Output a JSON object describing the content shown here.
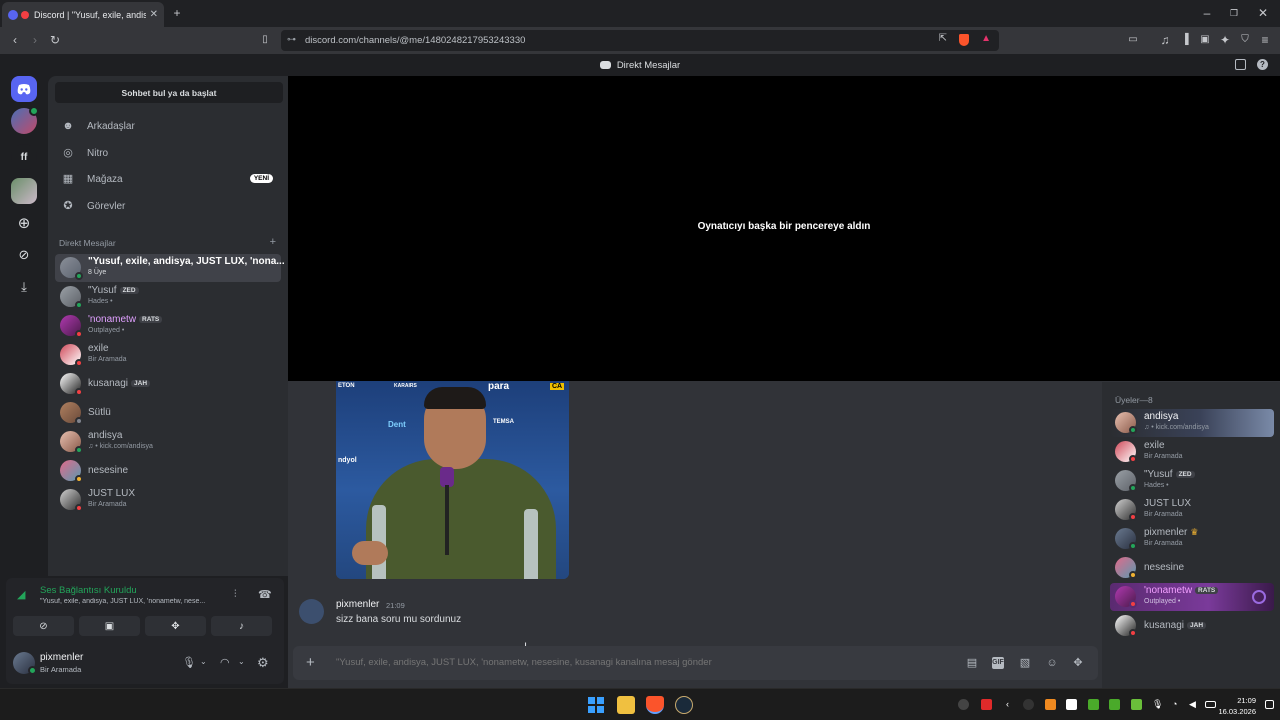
{
  "browser": {
    "tab_title": "Discord | \"Yusuf, exile, andis...",
    "url": "discord.com/channels/@me/1480248217953243330",
    "new_tab": "+"
  },
  "topbar": {
    "title": "Direkt Mesajlar"
  },
  "sidebar": {
    "search_button": "Sohbet bul ya da başlat",
    "nav": [
      {
        "label": "Arkadaşlar",
        "icon": "friends-icon"
      },
      {
        "label": "Nitro",
        "icon": "nitro-icon"
      },
      {
        "label": "Mağaza",
        "icon": "shop-icon",
        "badge": "YENİ"
      },
      {
        "label": "Görevler",
        "icon": "quests-icon"
      }
    ],
    "dm_header": "Direkt Mesajlar",
    "dms": [
      {
        "name": "\"Yusuf, exile, andisya, JUST LUX, 'nona...",
        "sub": "8 Üye"
      },
      {
        "name": "\"Yusuf",
        "tag": "ZED",
        "sub": "Hades •"
      },
      {
        "name": "'nonametw",
        "tag": "RATS",
        "sub": "Outplayed •"
      },
      {
        "name": "exile",
        "sub": "Bir Aramada"
      },
      {
        "name": "kusanagi",
        "tag": "JAH",
        "sub": ""
      },
      {
        "name": "Sütlü",
        "sub": ""
      },
      {
        "name": "andisya",
        "sub": "♫ • kick.com/andisya"
      },
      {
        "name": "nesesine",
        "sub": ""
      },
      {
        "name": "JUST LUX",
        "sub": "Bir Aramada"
      }
    ]
  },
  "voice": {
    "status": "Ses Bağlantısı Kuruldu",
    "channel": "\"Yusuf, exile, andisya, JUST LUX, 'nonametw, nese..."
  },
  "user": {
    "name": "pixmenler",
    "status": "Bir Aramada"
  },
  "stage": {
    "message": "Oynatıcıyı başka bir pencereye aldın"
  },
  "message": {
    "author": "pixmenler",
    "time": "21:09",
    "text": "sizz bana soru mu sordunuz"
  },
  "composer": {
    "placeholder": "\"Yusuf, exile, andisya, JUST LUX, 'nonametw, nesesine, kusanagi kanalına mesaj gönder"
  },
  "members": {
    "header": "Üyeler—8",
    "list": [
      {
        "name": "andisya",
        "sub": "♫ • kick.com/andisya"
      },
      {
        "name": "exile",
        "sub": "Bir Aramada"
      },
      {
        "name": "\"Yusuf",
        "tag": "ZED",
        "sub": "Hades •"
      },
      {
        "name": "JUST LUX",
        "sub": "Bir Aramada"
      },
      {
        "name": "pixmenler",
        "sub": "Bir Aramada"
      },
      {
        "name": "nesesine",
        "sub": ""
      },
      {
        "name": "'nonametw",
        "tag": "RATS",
        "sub": "Outplayed •"
      },
      {
        "name": "kusanagi",
        "tag": "JAH",
        "sub": ""
      }
    ]
  },
  "video_overlay_text": [
    "ETON",
    "KARAIRS",
    "para",
    "TEMSA",
    "Dent",
    "ndyol",
    "CA"
  ],
  "taskbar": {
    "time": "21:09",
    "date": "16.03.2026"
  },
  "colors": {
    "accent": "#5865f2",
    "online": "#23a55a",
    "dnd": "#f23f43",
    "idle": "#f0b232"
  }
}
